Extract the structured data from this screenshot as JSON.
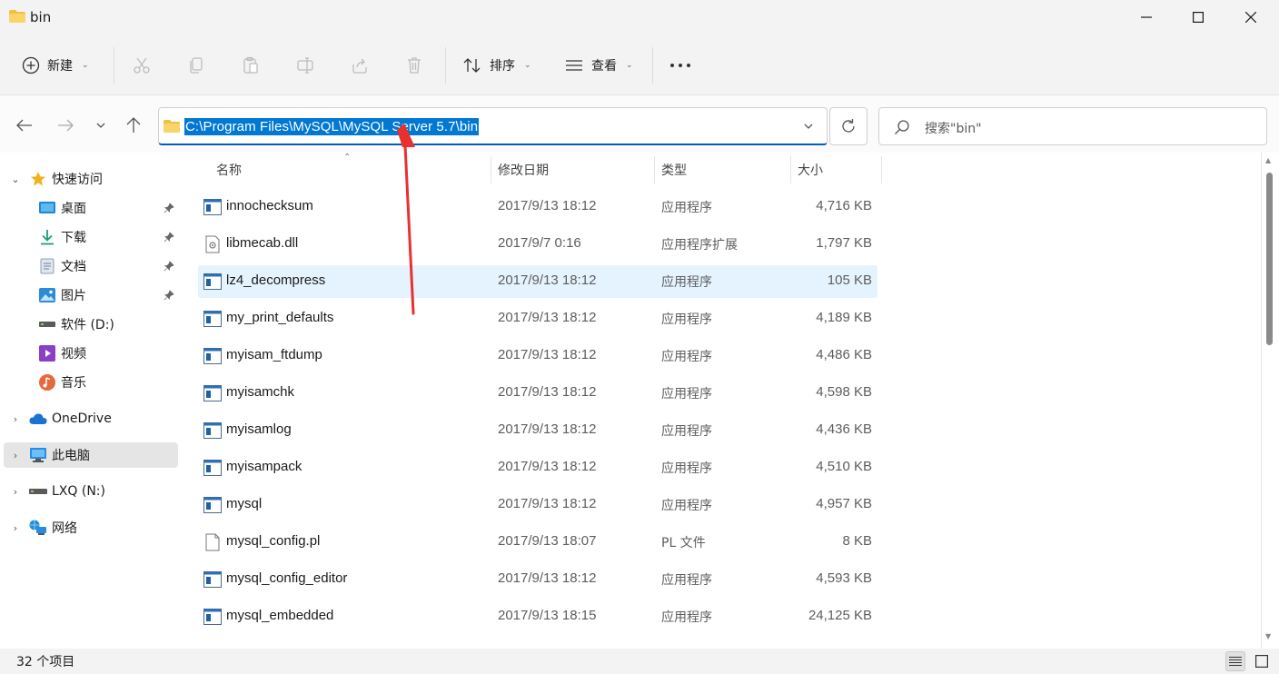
{
  "window": {
    "title": "bin",
    "minimize_icon": "minimize-icon",
    "maximize_icon": "maximize-icon",
    "close_icon": "close-icon"
  },
  "toolbar": {
    "new_label": "新建",
    "sort_label": "排序",
    "view_label": "查看",
    "icons": [
      "cut-icon",
      "copy-icon",
      "paste-icon",
      "rename-icon",
      "share-icon",
      "delete-icon"
    ]
  },
  "nav": {
    "address": "C:\\Program Files\\MySQL\\MySQL Server 5.7\\bin",
    "search_placeholder": "搜索\"bin\""
  },
  "sidebar": {
    "quick_access": "快速访问",
    "pinned": [
      {
        "label": "桌面",
        "icon": "desktop-icon"
      },
      {
        "label": "下载",
        "icon": "download-icon"
      },
      {
        "label": "文档",
        "icon": "documents-icon"
      },
      {
        "label": "图片",
        "icon": "pictures-icon"
      }
    ],
    "others": [
      {
        "label": "软件 (D:)",
        "icon": "drive-icon"
      },
      {
        "label": "视频",
        "icon": "videos-icon"
      },
      {
        "label": "音乐",
        "icon": "music-icon"
      }
    ],
    "onedrive": "OneDrive",
    "this_pc": "此电脑",
    "network_drive": "LXQ (N:)",
    "network": "网络"
  },
  "columns": {
    "name": "名称",
    "date": "修改日期",
    "type": "类型",
    "size": "大小"
  },
  "files": [
    {
      "name": "innochecksum",
      "date": "2017/9/13 18:12",
      "type": "应用程序",
      "size": "4,716 KB",
      "icon": "app-icon"
    },
    {
      "name": "libmecab.dll",
      "date": "2017/9/7 0:16",
      "type": "应用程序扩展",
      "size": "1,797 KB",
      "icon": "dll-icon"
    },
    {
      "name": "lz4_decompress",
      "date": "2017/9/13 18:12",
      "type": "应用程序",
      "size": "105 KB",
      "icon": "app-icon"
    },
    {
      "name": "my_print_defaults",
      "date": "2017/9/13 18:12",
      "type": "应用程序",
      "size": "4,189 KB",
      "icon": "app-icon"
    },
    {
      "name": "myisam_ftdump",
      "date": "2017/9/13 18:12",
      "type": "应用程序",
      "size": "4,486 KB",
      "icon": "app-icon"
    },
    {
      "name": "myisamchk",
      "date": "2017/9/13 18:12",
      "type": "应用程序",
      "size": "4,598 KB",
      "icon": "app-icon"
    },
    {
      "name": "myisamlog",
      "date": "2017/9/13 18:12",
      "type": "应用程序",
      "size": "4,436 KB",
      "icon": "app-icon"
    },
    {
      "name": "myisampack",
      "date": "2017/9/13 18:12",
      "type": "应用程序",
      "size": "4,510 KB",
      "icon": "app-icon"
    },
    {
      "name": "mysql",
      "date": "2017/9/13 18:12",
      "type": "应用程序",
      "size": "4,957 KB",
      "icon": "app-icon"
    },
    {
      "name": "mysql_config.pl",
      "date": "2017/9/13 18:07",
      "type": "PL 文件",
      "size": "8 KB",
      "icon": "file-icon"
    },
    {
      "name": "mysql_config_editor",
      "date": "2017/9/13 18:12",
      "type": "应用程序",
      "size": "4,593 KB",
      "icon": "app-icon"
    },
    {
      "name": "mysql_embedded",
      "date": "2017/9/13 18:15",
      "type": "应用程序",
      "size": "24,125 KB",
      "icon": "app-icon"
    }
  ],
  "status": {
    "item_count": "32 个项目"
  },
  "colors": {
    "accent": "#0078d4",
    "selection_bg": "#e5f3ff",
    "annotation_arrow": "#e8312f",
    "folder": "#f4c042"
  }
}
